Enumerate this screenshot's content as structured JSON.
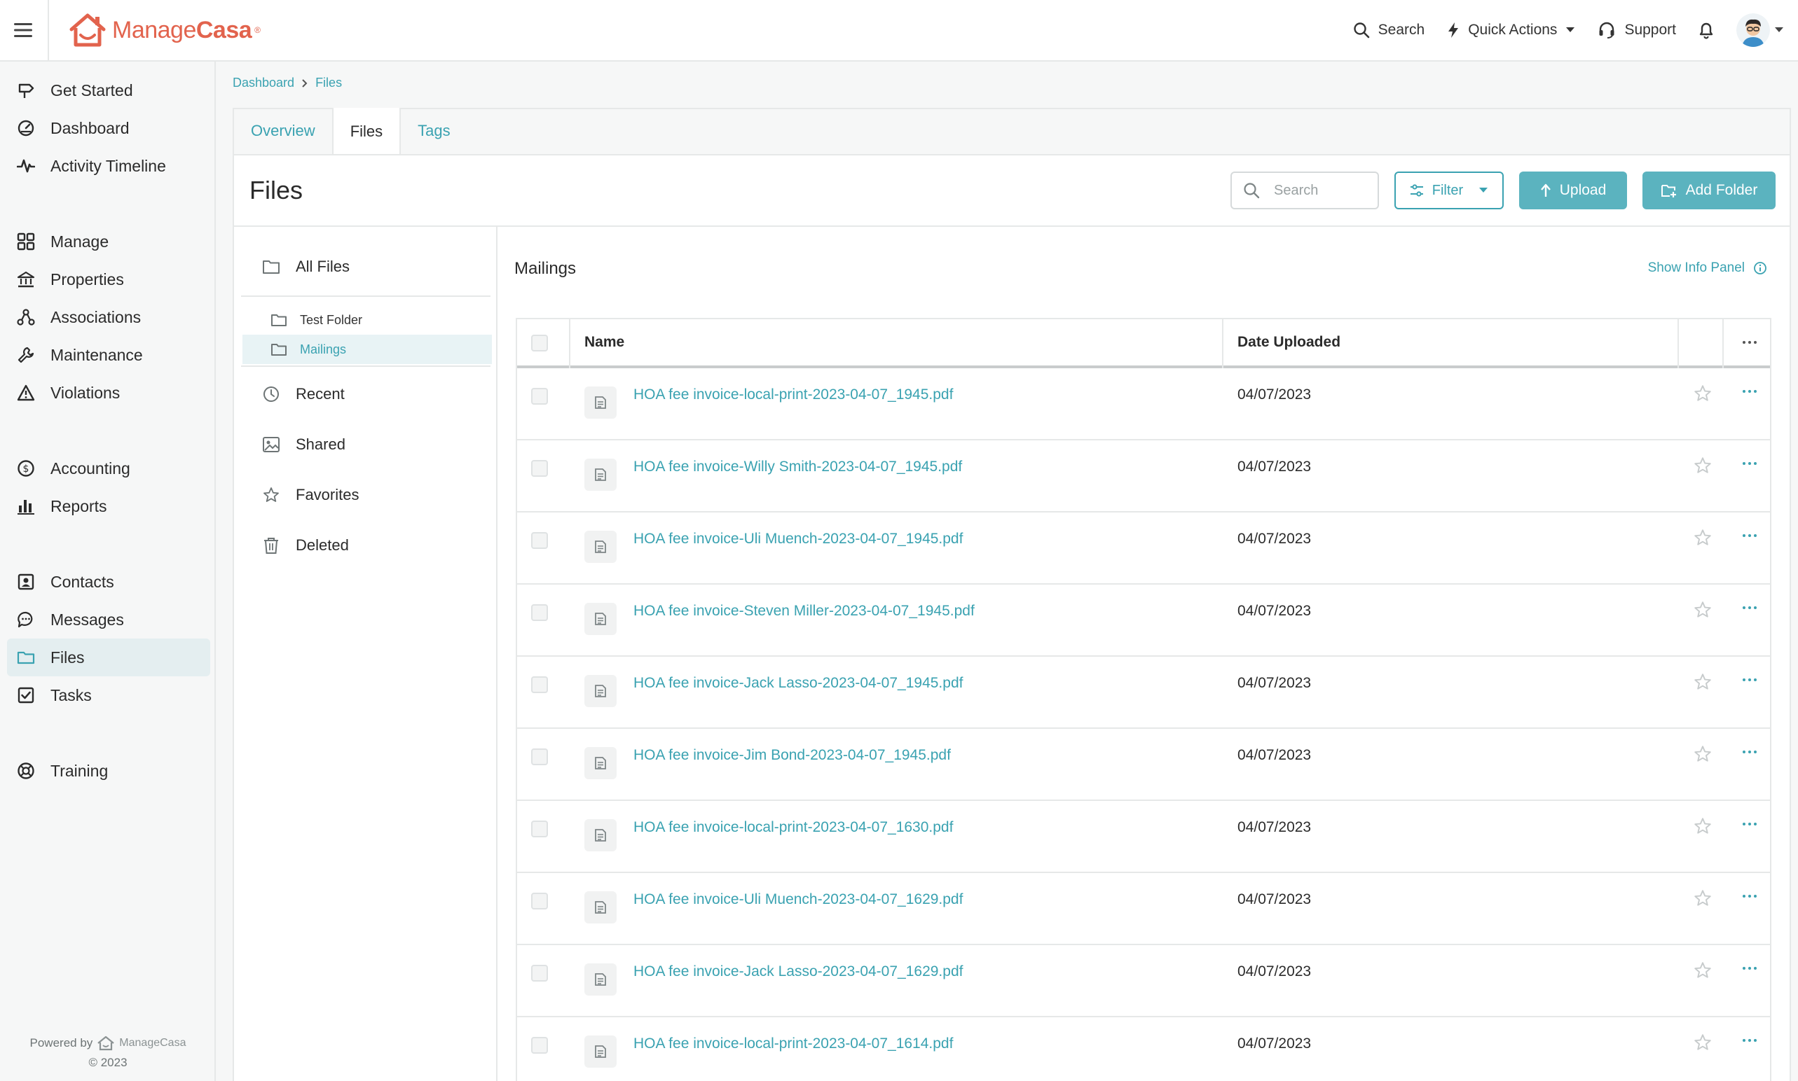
{
  "header": {
    "logo_text_regular": "Manage",
    "logo_text_bold": "Casa",
    "logo_mark": "®",
    "search_label": "Search",
    "quick_actions_label": "Quick Actions",
    "support_label": "Support"
  },
  "sidebar": {
    "items": [
      {
        "label": "Get Started",
        "icon": "signpost-icon"
      },
      {
        "label": "Dashboard",
        "icon": "gauge-icon"
      },
      {
        "label": "Activity Timeline",
        "icon": "activity-icon"
      },
      {
        "label": "Manage",
        "icon": "grid-icon"
      },
      {
        "label": "Properties",
        "icon": "bank-icon"
      },
      {
        "label": "Associations",
        "icon": "network-icon"
      },
      {
        "label": "Maintenance",
        "icon": "wrench-icon"
      },
      {
        "label": "Violations",
        "icon": "warning-icon"
      },
      {
        "label": "Accounting",
        "icon": "dollar-icon"
      },
      {
        "label": "Reports",
        "icon": "bar-chart-icon"
      },
      {
        "label": "Contacts",
        "icon": "contact-card-icon"
      },
      {
        "label": "Messages",
        "icon": "chat-icon"
      },
      {
        "label": "Files",
        "icon": "folder-icon"
      },
      {
        "label": "Tasks",
        "icon": "checkbox-icon"
      },
      {
        "label": "Training",
        "icon": "lifebuoy-icon"
      }
    ],
    "powered_by": "Powered by",
    "powered_logo": "ManageCasa",
    "copyright": "© 2023"
  },
  "breadcrumb": {
    "home": "Dashboard",
    "current": "Files"
  },
  "tabs": [
    "Overview",
    "Files",
    "Tags"
  ],
  "page": {
    "title": "Files",
    "search_placeholder": "Search",
    "filter_label": "Filter",
    "upload_label": "Upload",
    "add_folder_label": "Add Folder"
  },
  "folders": {
    "all_files": "All Files",
    "subfolders": [
      "Test Folder",
      "Mailings"
    ],
    "recent": "Recent",
    "shared": "Shared",
    "favorites": "Favorites",
    "deleted": "Deleted"
  },
  "list": {
    "title": "Mailings",
    "info_panel_label": "Show Info Panel",
    "col_name": "Name",
    "col_date": "Date Uploaded",
    "rows": [
      {
        "name": "HOA fee invoice-local-print-2023-04-07_1945.pdf",
        "date": "04/07/2023"
      },
      {
        "name": "HOA fee invoice-Willy Smith-2023-04-07_1945.pdf",
        "date": "04/07/2023"
      },
      {
        "name": "HOA fee invoice-Uli Muench-2023-04-07_1945.pdf",
        "date": "04/07/2023"
      },
      {
        "name": "HOA fee invoice-Steven Miller-2023-04-07_1945.pdf",
        "date": "04/07/2023"
      },
      {
        "name": "HOA fee invoice-Jack Lasso-2023-04-07_1945.pdf",
        "date": "04/07/2023"
      },
      {
        "name": "HOA fee invoice-Jim Bond-2023-04-07_1945.pdf",
        "date": "04/07/2023"
      },
      {
        "name": "HOA fee invoice-local-print-2023-04-07_1630.pdf",
        "date": "04/07/2023"
      },
      {
        "name": "HOA fee invoice-Uli Muench-2023-04-07_1629.pdf",
        "date": "04/07/2023"
      },
      {
        "name": "HOA fee invoice-Jack Lasso-2023-04-07_1629.pdf",
        "date": "04/07/2023"
      },
      {
        "name": "HOA fee invoice-local-print-2023-04-07_1614.pdf",
        "date": "04/07/2023"
      }
    ]
  },
  "colors": {
    "brand": "#e2634d",
    "accent": "#3aa2b1",
    "button": "#5bb3bf",
    "active_nav": "#e4eef0"
  }
}
